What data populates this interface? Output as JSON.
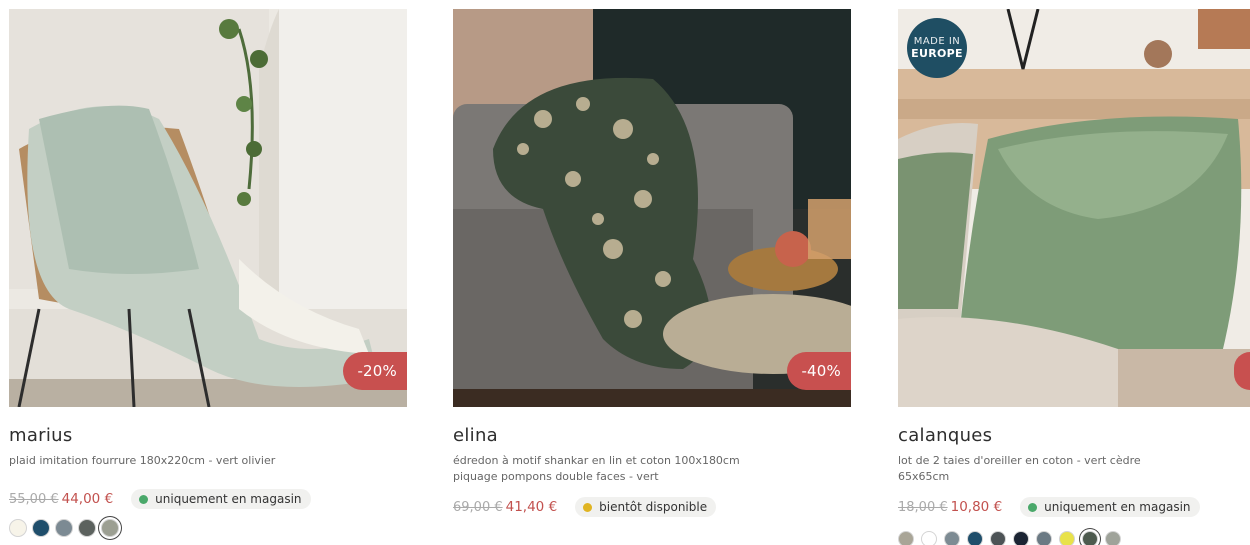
{
  "products": [
    {
      "name": "marius",
      "description_lines": [
        "plaid imitation fourrure 180x220cm - vert olivier"
      ],
      "old_price": "55,00 €",
      "new_price": "44,00 €",
      "discount": "-20%",
      "availability": "uniquement en magasin",
      "availability_color": "#4aa86a",
      "swatches": [
        "#f7f4e9",
        "#1f4e6b",
        "#7c8a93",
        "#5c625e",
        "#9c9f92"
      ],
      "selected_swatch": 4
    },
    {
      "name": "elina",
      "description_lines": [
        "édredon à motif shankar en lin et coton 100x180cm",
        "piquage pompons double faces - vert"
      ],
      "old_price": "69,00 €",
      "new_price": "41,40 €",
      "discount": "-40%",
      "availability": "bientôt disponible",
      "availability_color": "#e0b422"
    },
    {
      "name": "calanques",
      "description_lines": [
        "lot de 2 taies d'oreiller en coton - vert cèdre",
        "65x65cm"
      ],
      "old_price": "18,00 €",
      "new_price": "10,80 €",
      "discount": "",
      "availability": "uniquement en magasin",
      "availability_color": "#4aa86a",
      "made_in": {
        "line1": "MADE IN",
        "line2": "EUROPE"
      },
      "swatches": [
        "#a9a597",
        "#ffffff",
        "#7d8b93",
        "#1f4e6b",
        "#4d5356",
        "#1b2433",
        "#6b7a84",
        "#e8e24a",
        "#4d5a4e",
        "#9fa39a"
      ],
      "selected_swatch": 8
    }
  ],
  "colors": {
    "sale": "#c8504f",
    "made_in_badge": "#1f4e63"
  }
}
